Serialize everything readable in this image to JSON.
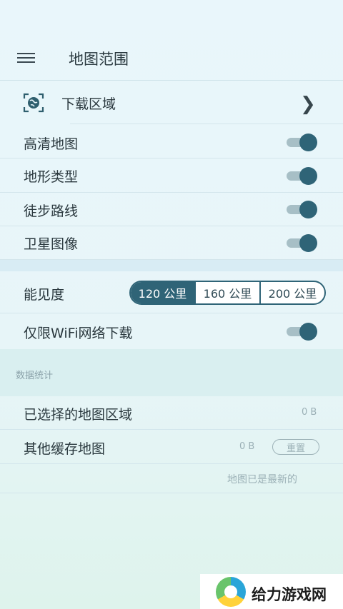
{
  "header": {
    "title": "地图范围"
  },
  "download_area": {
    "label": "下载区域"
  },
  "toggles": [
    {
      "label": "高清地图",
      "on": true
    },
    {
      "label": "地形类型",
      "on": true
    },
    {
      "label": "徒步路线",
      "on": true
    },
    {
      "label": "卫星图像",
      "on": true
    }
  ],
  "visibility": {
    "label": "能见度",
    "options": [
      "120 公里",
      "160 公里",
      "200 公里"
    ],
    "selected": "120 公里"
  },
  "wifi_only": {
    "label": "仅限WiFi网络下载",
    "on": true
  },
  "stats": {
    "title": "数据统计",
    "selected_regions": {
      "label": "已选择的地图区域",
      "value": "0 B"
    },
    "other_cache": {
      "label": "其他缓存地图",
      "value": "0 B",
      "reset_label": "重置"
    },
    "note": "地图已是最新的"
  },
  "colors": {
    "accent": "#2f6477",
    "background": "#e9f6fb"
  },
  "watermark": {
    "text": "给力游戏网"
  }
}
